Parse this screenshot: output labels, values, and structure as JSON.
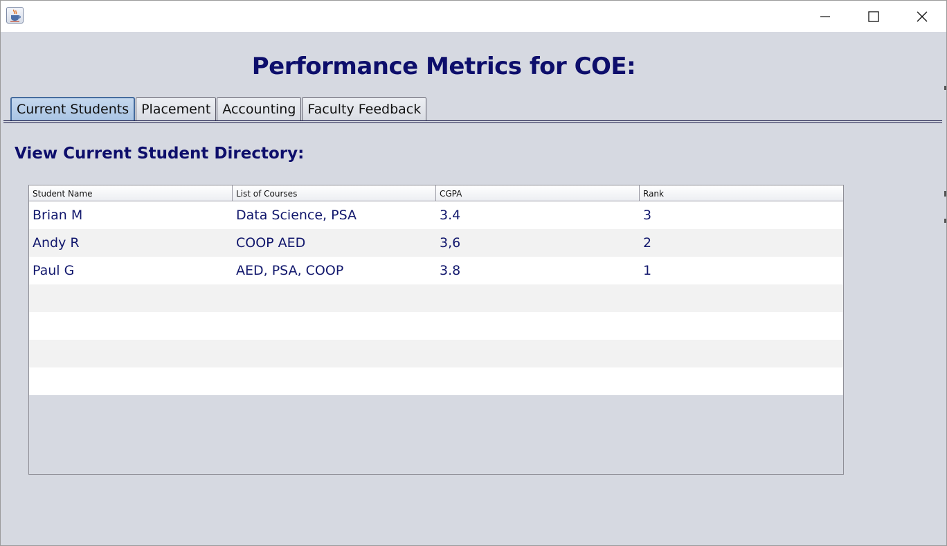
{
  "window": {
    "icon": "java-cup-icon",
    "controls": [
      "minimize-icon",
      "maximize-icon",
      "close-icon"
    ]
  },
  "page_title": "Performance Metrics for COE:",
  "tabs": [
    {
      "label": "Current Students",
      "active": true
    },
    {
      "label": "Placement",
      "active": false
    },
    {
      "label": "Accounting",
      "active": false
    },
    {
      "label": "Faculty Feedback",
      "active": false
    }
  ],
  "section_title": "View Current Student Directory:",
  "table": {
    "columns": [
      "Student Name",
      "List of Courses",
      "CGPA",
      "Rank"
    ],
    "rows": [
      [
        "Brian M",
        "Data Science, PSA",
        "3.4",
        "3"
      ],
      [
        "Andy R",
        "COOP AED",
        "3,6",
        "2"
      ],
      [
        "Paul G",
        "AED, PSA, COOP",
        "3.8",
        "1"
      ],
      [
        "",
        "",
        "",
        ""
      ],
      [
        "",
        "",
        "",
        ""
      ],
      [
        "",
        "",
        "",
        ""
      ],
      [
        "",
        "",
        "",
        ""
      ]
    ]
  },
  "colors": {
    "heading": "#0d0e6b",
    "cell_text": "#12186d",
    "background": "#d6d9e1",
    "active_tab": "#a9c4e4"
  }
}
